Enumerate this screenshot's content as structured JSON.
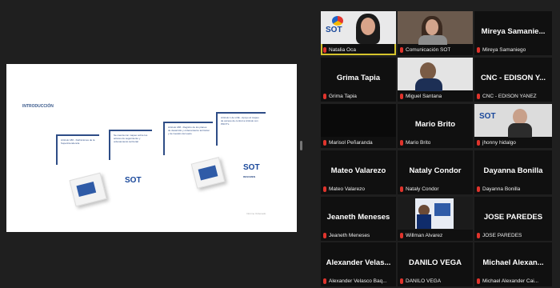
{
  "slide": {
    "title": "INTRODUCCIÓN",
    "steps": [
      "Artículo 186 - Definiciones de la Superintendencia",
      "Se cuenta con mapeo sobre los actores de seguimiento y ordenamiento territorial",
      "Artículo 188 - Registro de los planes de desarrollo y ordenamiento territorial y de Gestión del suelo",
      "Artículo 1 de LOE - Apoyo al mapeo de acceso de control a Artículo con PDOT's"
    ],
    "brand": "SOT",
    "cover_heading": "RESUMEN",
    "footer": "Informe Ordenado"
  },
  "participants": [
    {
      "name": "Natalia Oca",
      "video": true,
      "active": true,
      "style": "woman-sot"
    },
    {
      "name": "Comunicación SOT",
      "video": true,
      "style": "woman"
    },
    {
      "name": "Mireya Samaniego",
      "display": "Mireya Samanie..."
    },
    {
      "name": "Grima Tapia",
      "display": "Grima Tapia"
    },
    {
      "name": "Miguel Santana",
      "video": true,
      "style": "man"
    },
    {
      "name": "CNC - EDISON YANEZ",
      "display": "CNC - EDISON Y..."
    },
    {
      "name": "Marisol Peñaranda",
      "video": true,
      "style": "dark"
    },
    {
      "name": "Mario Brito",
      "display": "Mario Brito"
    },
    {
      "name": "jhonny hidalgo",
      "video": true,
      "style": "man-sot"
    },
    {
      "name": "Mateo Valarezo",
      "display": "Mateo Valarezo"
    },
    {
      "name": "Nataly Condor",
      "display": "Nataly Condor"
    },
    {
      "name": "Dayanna Bonilla",
      "display": "Dayanna Bonilla"
    },
    {
      "name": "Jeaneth Meneses",
      "display": "Jeaneth Meneses"
    },
    {
      "name": "Willman Alvarez",
      "video": true,
      "style": "man-screen"
    },
    {
      "name": "JOSE PAREDES",
      "display": "JOSE PAREDES"
    },
    {
      "name": "Alexander Velasco Baq...",
      "display": "Alexander Velas..."
    },
    {
      "name": "DANILO VEGA",
      "display": "DANILO VEGA"
    },
    {
      "name": "Michael Alexander Cai...",
      "display": "Michael Alexan..."
    }
  ]
}
